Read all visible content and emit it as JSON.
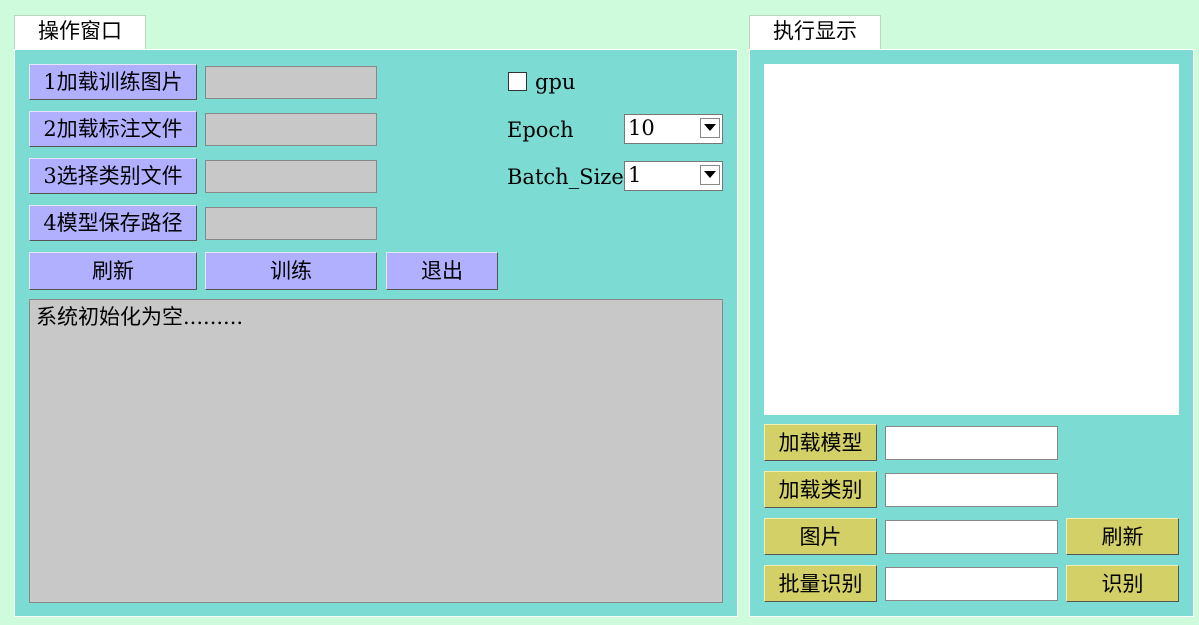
{
  "left_panel": {
    "tab_label": "操作窗口",
    "buttons": {
      "load_train_images": "1加载训练图片",
      "load_annotations": "2加载标注文件",
      "select_class_file": "3选择类别文件",
      "model_save_path": "4模型保存路径",
      "refresh": "刷新",
      "train": "训练",
      "exit": "退出"
    },
    "gpu_label": "gpu",
    "epoch_label": "Epoch",
    "epoch_value": "10",
    "batch_size_label": "Batch_Size",
    "batch_size_value": "1",
    "log_text": "系统初始化为空........."
  },
  "right_panel": {
    "tab_label": "执行显示",
    "buttons": {
      "load_model": "加载模型",
      "load_classes": "加载类别",
      "image": "图片",
      "refresh": "刷新",
      "batch_recognize": "批量识别",
      "recognize": "识别"
    }
  },
  "colors": {
    "background": "#cdfbdb",
    "panel": "#7cdcd4",
    "blue_button": "#b0b0ff",
    "yellow_button": "#d2d066",
    "gray_field": "#c8c8c8"
  }
}
